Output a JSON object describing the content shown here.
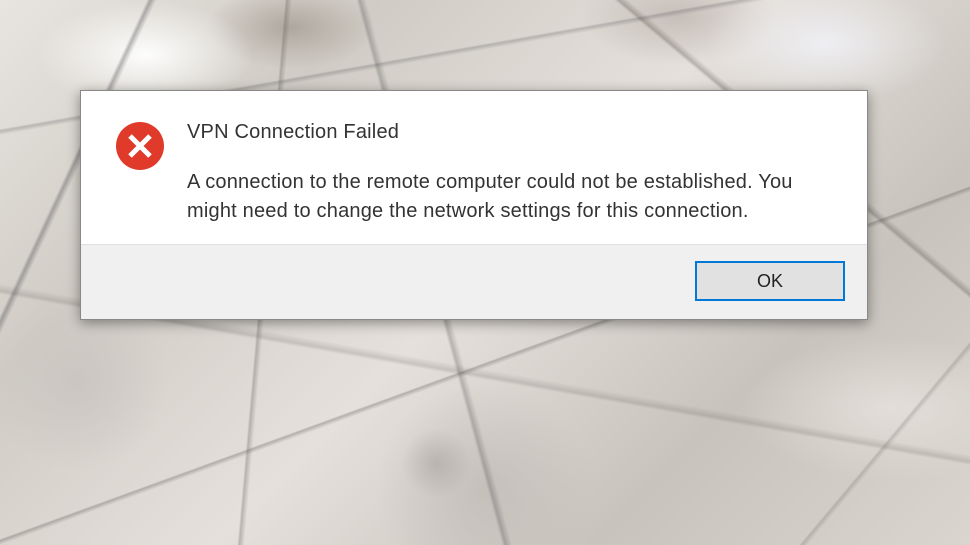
{
  "dialog": {
    "icon": "error-x-icon",
    "icon_color": "#e03b2a",
    "title": "VPN Connection Failed",
    "message": "A connection to the remote computer could not be established.  You might need to change the network settings for this connection.",
    "buttons": {
      "ok_label": "OK"
    }
  }
}
